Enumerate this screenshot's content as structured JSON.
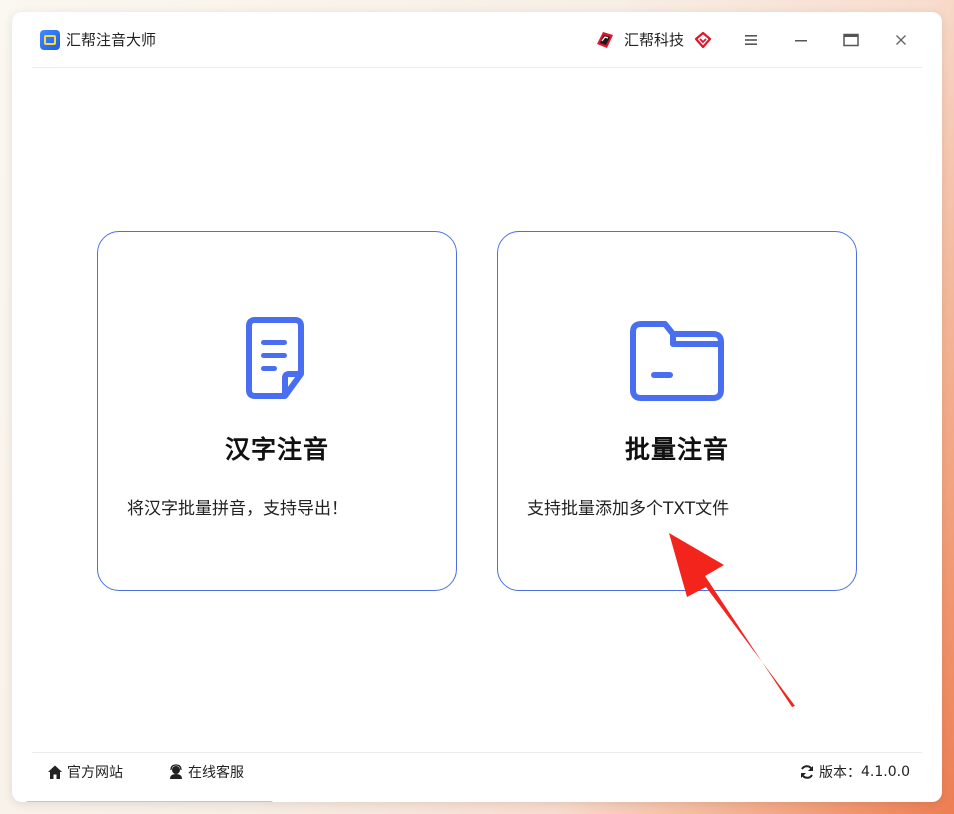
{
  "app": {
    "title": "汇帮注音大师"
  },
  "header": {
    "brand_name": "汇帮科技"
  },
  "cards": [
    {
      "title": "汉字注音",
      "description": "将汉字批量拼音，支持导出！",
      "icon": "document-icon"
    },
    {
      "title": "批量注音",
      "description": "支持批量添加多个TXT文件",
      "icon": "folder-icon"
    }
  ],
  "footer": {
    "website": "官方网站",
    "support": "在线客服",
    "version_label": "版本：",
    "version": "4.1.0.0"
  },
  "progress": {
    "fraction": 0.27
  },
  "colors": {
    "accent": "#4a6ef0",
    "card_border": "#4f6fe0",
    "arrow": "#f2241c",
    "brand_red": "#e0162b"
  }
}
